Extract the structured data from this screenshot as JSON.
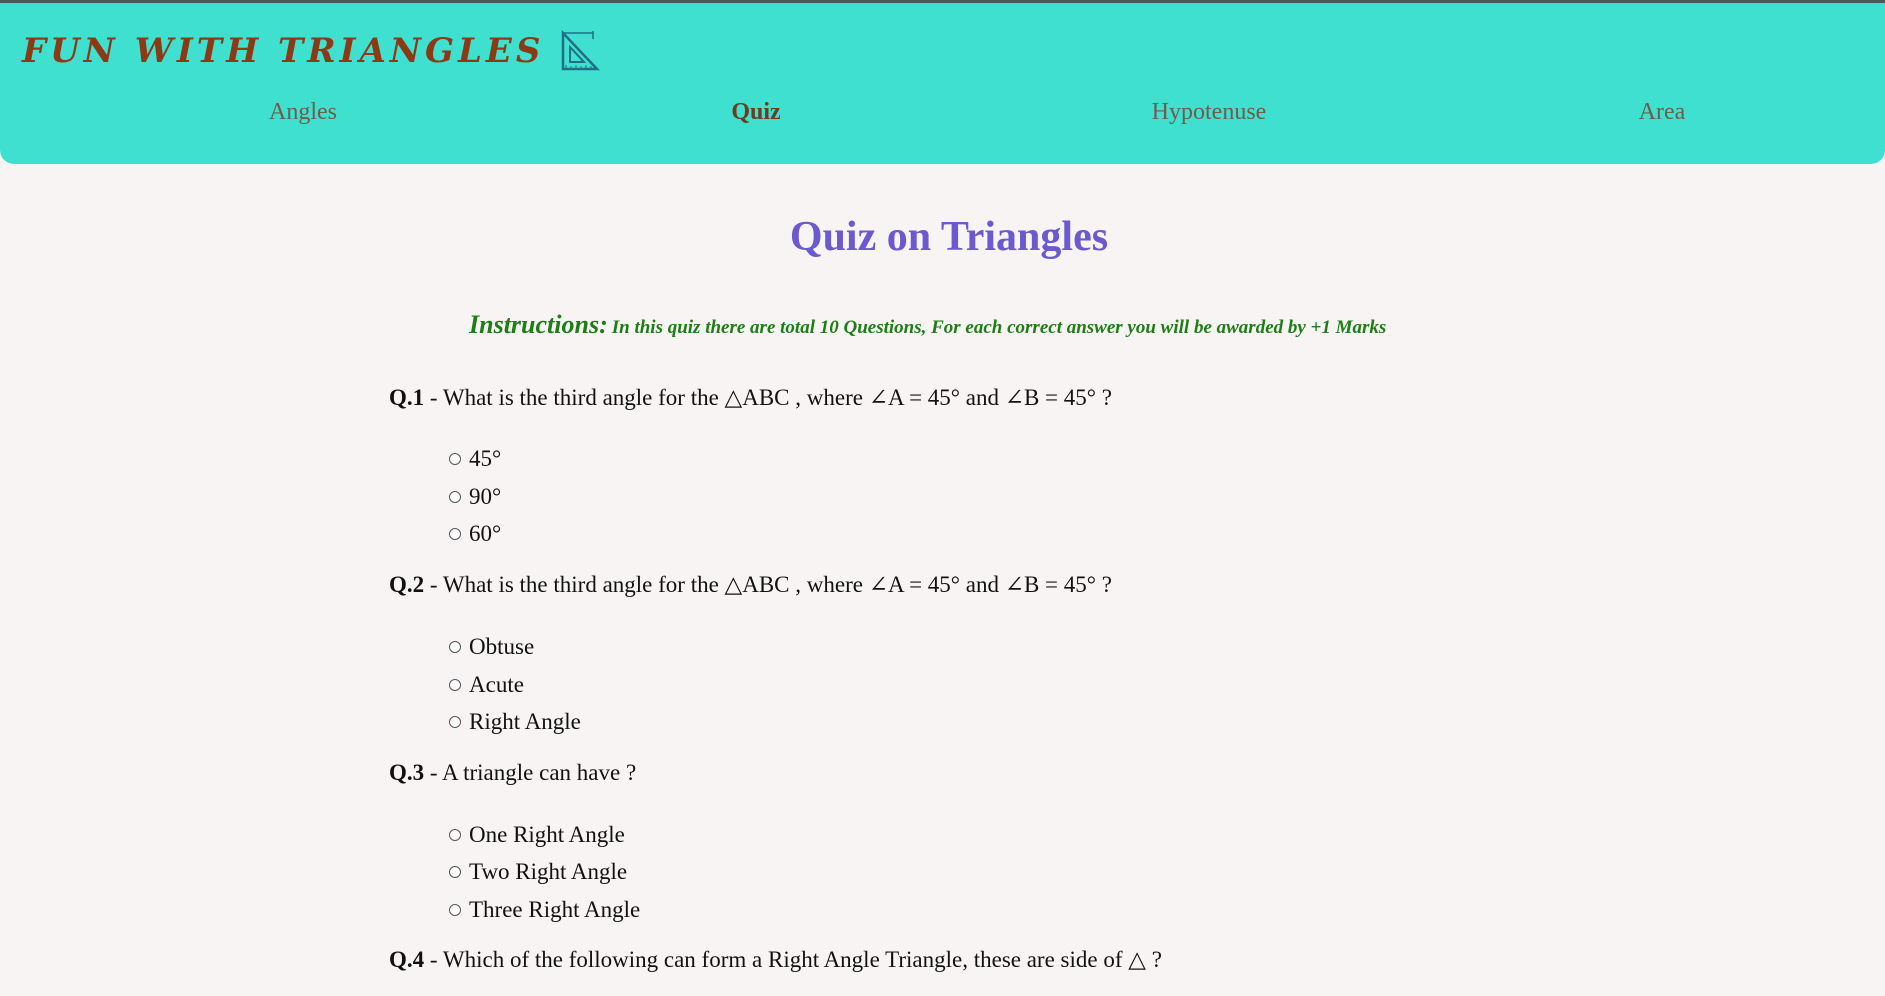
{
  "header": {
    "brand_title": "Fun with Triangles",
    "brand_icon": "set-square-icon",
    "nav": [
      {
        "label": "Angles",
        "active": false
      },
      {
        "label": "Quiz",
        "active": true
      },
      {
        "label": "Hypotenuse",
        "active": false
      },
      {
        "label": "Area",
        "active": false
      }
    ]
  },
  "main": {
    "title": "Quiz on Triangles",
    "instructions_label": "Instructions:",
    "instructions_text": "In this quiz there are total 10 Questions, For each correct answer you will be awarded by +1 Marks",
    "questions": [
      {
        "number": "Q.1",
        "text": " - What is the third angle for the △ABC , where ∠A = 45° and ∠B = 45° ?",
        "options": [
          "45°",
          "90°",
          "60°"
        ]
      },
      {
        "number": "Q.2",
        "text": " - What is the third angle for the △ABC , where ∠A = 45° and ∠B = 45° ?",
        "options": [
          "Obtuse",
          "Acute",
          "Right Angle"
        ]
      },
      {
        "number": "Q.3",
        "text": " - A triangle can have ?",
        "options": [
          "One Right Angle",
          "Two Right Angle",
          "Three Right Angle"
        ]
      },
      {
        "number": "Q.4",
        "text": " - Which of the following can form a Right Angle Triangle, these are side of △ ?",
        "options": []
      }
    ]
  },
  "colors": {
    "header_bg": "#40e0d0",
    "brand": "#8b3a16",
    "title": "#6a5acd",
    "instructions": "#1e7d17",
    "page_bg": "#f8f4f3"
  }
}
